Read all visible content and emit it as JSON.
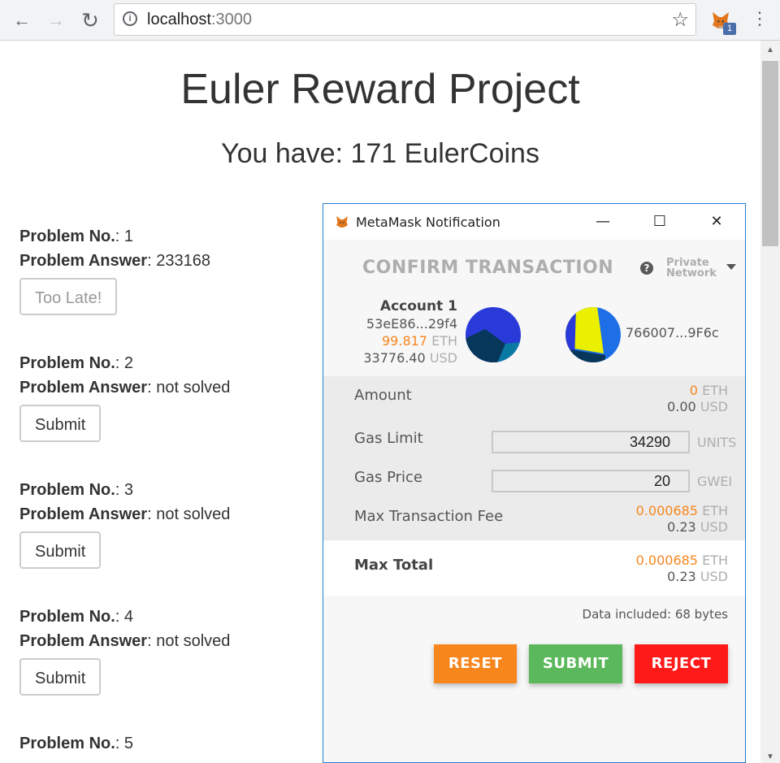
{
  "browser": {
    "url_host": "localhost",
    "url_port": ":3000",
    "extension_badge": "1",
    "back": "←",
    "forward": "→",
    "reload": "↻",
    "info": "i",
    "star": "☆",
    "menu": "⋮"
  },
  "page": {
    "title": "Euler Reward Project",
    "balance": "You have: 171 EulerCoins",
    "problems": [
      {
        "no_label": "Problem No.",
        "no": ": 1",
        "answer_label": "Problem Answer",
        "answer": ": 233168",
        "button": "Too Late!"
      },
      {
        "no_label": "Problem No.",
        "no": ": 2",
        "answer_label": "Problem Answer",
        "answer": ": not solved",
        "button": "Submit"
      },
      {
        "no_label": "Problem No.",
        "no": ": 3",
        "answer_label": "Problem Answer",
        "answer": ": not solved",
        "button": "Submit"
      },
      {
        "no_label": "Problem No.",
        "no": ": 4",
        "answer_label": "Problem Answer",
        "answer": ": not solved",
        "button": "Submit"
      },
      {
        "no_label": "Problem No.",
        "no": ": 5"
      }
    ]
  },
  "metamask": {
    "window_title": "MetaMask Notification",
    "minimize": "—",
    "maximize": "☐",
    "close": "✕",
    "heading": "CONFIRM TRANSACTION",
    "help": "?",
    "network_line1": "Private",
    "network_line2": "Network",
    "from": {
      "name": "Account 1",
      "address": "53eE86...29f4",
      "eth_value": "99.817",
      "eth_unit": "ETH",
      "usd_value": "33776.40",
      "usd_unit": "USD"
    },
    "to_address": "766007...9F6c",
    "amount": {
      "label": "Amount",
      "eth": "0",
      "eth_unit": "ETH",
      "usd": "0.00",
      "usd_unit": "USD"
    },
    "gas_limit": {
      "label": "Gas Limit",
      "value": "34290",
      "unit": "UNITS"
    },
    "gas_price": {
      "label": "Gas Price",
      "value": "20",
      "unit": "GWEI"
    },
    "max_fee": {
      "label": "Max Transaction Fee",
      "eth": "0.000685",
      "eth_unit": "ETH",
      "usd": "0.23",
      "usd_unit": "USD"
    },
    "max_total": {
      "label": "Max Total",
      "eth": "0.000685",
      "eth_unit": "ETH",
      "usd": "0.23",
      "usd_unit": "USD"
    },
    "data_included": "Data included: 68 bytes",
    "buttons": {
      "reset": "RESET",
      "submit": "SUBMIT",
      "reject": "REJECT"
    },
    "colors": {
      "reset": "#f7861c",
      "submit": "#5cb85c",
      "reject": "#ff0000",
      "accent": "#f7861c"
    }
  }
}
